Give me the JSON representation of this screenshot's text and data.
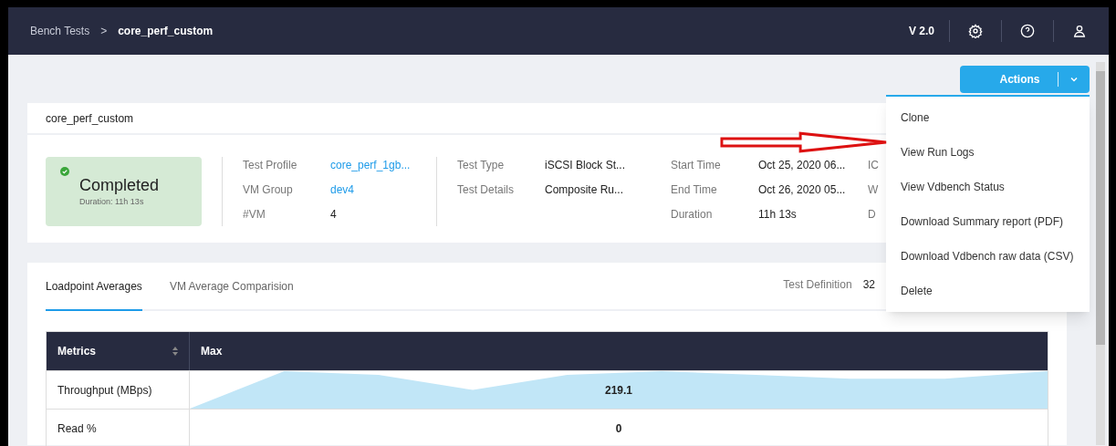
{
  "breadcrumb": [
    {
      "label": "Bench Tests",
      "selected": false
    },
    {
      "label": "core_perf_custom",
      "selected": true
    }
  ],
  "breadcrumb_separator": ">",
  "version": "V 2.0",
  "actions_button": {
    "label": "Actions",
    "expanded": true
  },
  "actions_menu": [
    "Clone",
    "View Run Logs",
    "View Vdbench Status",
    "Download Summary report (PDF)",
    "Download Vdbench raw data (CSV)",
    "Delete"
  ],
  "test": {
    "name": "core_perf_custom",
    "status": "Completed",
    "duration_label": "Duration: 11h 13s",
    "groups": [
      [
        {
          "label": "Test Profile",
          "value": "core_perf_1gb...",
          "link": true
        },
        {
          "label": "VM Group",
          "value": "dev4",
          "link": true
        },
        {
          "label": "#VM",
          "value": "4",
          "link": false
        }
      ],
      [
        {
          "label": "Test Type",
          "value": "iSCSI Block St...",
          "link": false
        },
        {
          "label": "Test Details",
          "value": "Composite Ru...",
          "link": false
        }
      ],
      [
        {
          "label": "Start Time",
          "value": "Oct 25, 2020 06...",
          "link": false
        },
        {
          "label": "End Time",
          "value": "Oct 26, 2020 05...",
          "link": false
        },
        {
          "label": "Duration",
          "value": "11h 13s",
          "link": false
        }
      ]
    ],
    "covered_labels": [
      "IC",
      "W",
      "D"
    ]
  },
  "tabs": [
    {
      "label": "Loadpoint Averages",
      "selected": true
    },
    {
      "label": "VM Average Comparision",
      "selected": false
    }
  ],
  "test_definition": {
    "label": "Test Definition",
    "value": "32"
  },
  "table": {
    "columns": [
      "Metrics",
      "Max"
    ],
    "rows": [
      {
        "metric": "Throughput (MBps)",
        "max": "219.1",
        "sparkline": true
      },
      {
        "metric": "Read %",
        "max": "0",
        "sparkline": false
      }
    ]
  }
}
